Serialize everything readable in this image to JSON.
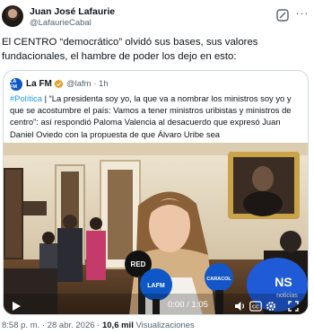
{
  "author": {
    "name": "Juan José Lafaurie",
    "handle": "@LafaurieCabal"
  },
  "tweet": {
    "text": "El CENTRO “democrático” olvidó sus bases, sus valores fundacionales, el hambre de poder los dejo en esto:"
  },
  "quote": {
    "avatar_text": "LA FM",
    "name": "La FM",
    "handle": "@lafm · 1h",
    "hashtag": "#Política",
    "text": " | “La presidenta soy yo, la que va a nombrar los ministros soy yo y que se acostumbre el país: Vamos a tener ministros uribistas y ministros de centro”: así respondió Paloma Valencia al desacuerdo que expresó Juan Daniel Oviedo con la propuesta de que Álvaro Uribe sea",
    "video": {
      "time": "0:00 / 1:05",
      "mic_labels": [
        "RED",
        "LAFM",
        "CARACOL",
        "NS"
      ],
      "mic_extra": "noticias"
    }
  },
  "meta": {
    "time": "8:58 p. m.",
    "date": "28 abr. 2026",
    "views_count": "10,6 mil",
    "views_label": "Visualizaciones",
    "separator": "·"
  },
  "colors": {
    "accent": "#1d9bf0",
    "verified": "#e0a32c",
    "lafm_blue": "#0d58c6"
  }
}
